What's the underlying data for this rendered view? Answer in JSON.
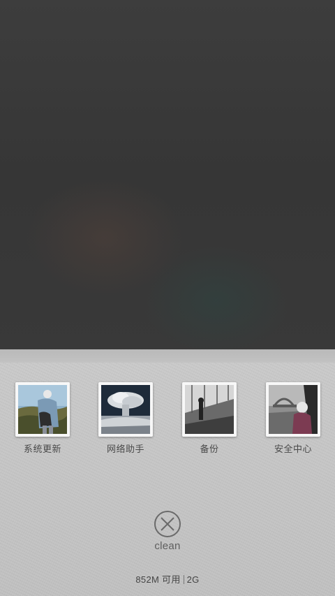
{
  "shortcuts": [
    {
      "label": "系统更新",
      "icon": "system-update-thumbnail"
    },
    {
      "label": "网络助手",
      "icon": "network-assistant-thumbnail"
    },
    {
      "label": "备份",
      "icon": "backup-thumbnail"
    },
    {
      "label": "安全中心",
      "icon": "security-center-thumbnail"
    }
  ],
  "clean": {
    "label": "clean",
    "icon": "clean-x-icon"
  },
  "memory": {
    "available": "852M 可用",
    "total": "2G"
  },
  "colors": {
    "panel": "#c5c5c5",
    "text": "#4a4a4a",
    "blur_bg": "#3a3a3a"
  }
}
